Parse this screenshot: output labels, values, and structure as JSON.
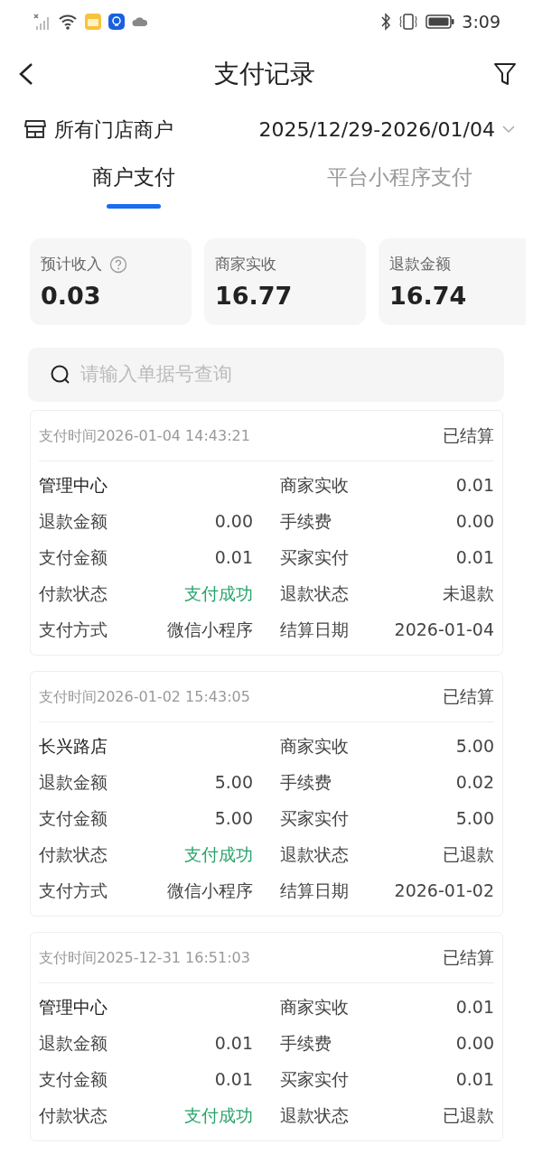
{
  "status_bar": {
    "time": "3:09"
  },
  "header": {
    "title": "支付记录"
  },
  "filter_row": {
    "store": "所有门店商户",
    "date_range": "2025/12/29-2026/01/04"
  },
  "tabs": [
    {
      "label": "商户支付",
      "selected": true
    },
    {
      "label": "平台小程序支付",
      "selected": false
    }
  ],
  "summary": [
    {
      "label": "预计收入",
      "value": "0.03",
      "help": true
    },
    {
      "label": "商家实收",
      "value": "16.77",
      "help": false
    },
    {
      "label": "退款金额",
      "value": "16.74",
      "help": false
    }
  ],
  "search": {
    "placeholder": "请输入单据号查询"
  },
  "records": [
    {
      "time": "支付时间2026-01-04 14:43:21",
      "settlement": "已结算",
      "rows": [
        [
          {
            "value": "管理中心",
            "kind": "store"
          },
          {
            "label": "商家实收",
            "value": "0.01",
            "kind": "plain"
          }
        ],
        [
          {
            "label": "退款金额",
            "value": "0.00",
            "kind": "plain"
          },
          {
            "label": "手续费",
            "value": "0.00",
            "kind": "plain"
          }
        ],
        [
          {
            "label": "支付金额",
            "value": "0.01",
            "kind": "plain"
          },
          {
            "label": "买家实付",
            "value": "0.01",
            "kind": "plain"
          }
        ],
        [
          {
            "label": "付款状态",
            "value": "支付成功",
            "kind": "success"
          },
          {
            "label": "退款状态",
            "value": "未退款",
            "kind": "plain"
          }
        ],
        [
          {
            "label": "支付方式",
            "value": "微信小程序",
            "kind": "plain"
          },
          {
            "label": "结算日期",
            "value": "2026-01-04",
            "kind": "plain"
          }
        ]
      ]
    },
    {
      "time": "支付时间2026-01-02 15:43:05",
      "settlement": "已结算",
      "rows": [
        [
          {
            "value": "长兴路店",
            "kind": "store"
          },
          {
            "label": "商家实收",
            "value": "5.00",
            "kind": "plain"
          }
        ],
        [
          {
            "label": "退款金额",
            "value": "5.00",
            "kind": "plain"
          },
          {
            "label": "手续费",
            "value": "0.02",
            "kind": "plain"
          }
        ],
        [
          {
            "label": "支付金额",
            "value": "5.00",
            "kind": "plain"
          },
          {
            "label": "买家实付",
            "value": "5.00",
            "kind": "plain"
          }
        ],
        [
          {
            "label": "付款状态",
            "value": "支付成功",
            "kind": "success"
          },
          {
            "label": "退款状态",
            "value": "已退款",
            "kind": "plain"
          }
        ],
        [
          {
            "label": "支付方式",
            "value": "微信小程序",
            "kind": "plain"
          },
          {
            "label": "结算日期",
            "value": "2026-01-02",
            "kind": "plain"
          }
        ]
      ]
    },
    {
      "time": "支付时间2025-12-31 16:51:03",
      "settlement": "已结算",
      "rows": [
        [
          {
            "value": "管理中心",
            "kind": "store"
          },
          {
            "label": "商家实收",
            "value": "0.01",
            "kind": "plain"
          }
        ],
        [
          {
            "label": "退款金额",
            "value": "0.01",
            "kind": "plain"
          },
          {
            "label": "手续费",
            "value": "0.00",
            "kind": "plain"
          }
        ],
        [
          {
            "label": "支付金额",
            "value": "0.01",
            "kind": "plain"
          },
          {
            "label": "买家实付",
            "value": "0.01",
            "kind": "plain"
          }
        ],
        [
          {
            "label": "付款状态",
            "value": "支付成功",
            "kind": "success"
          },
          {
            "label": "退款状态",
            "value": "已退款",
            "kind": "plain"
          }
        ]
      ]
    }
  ]
}
